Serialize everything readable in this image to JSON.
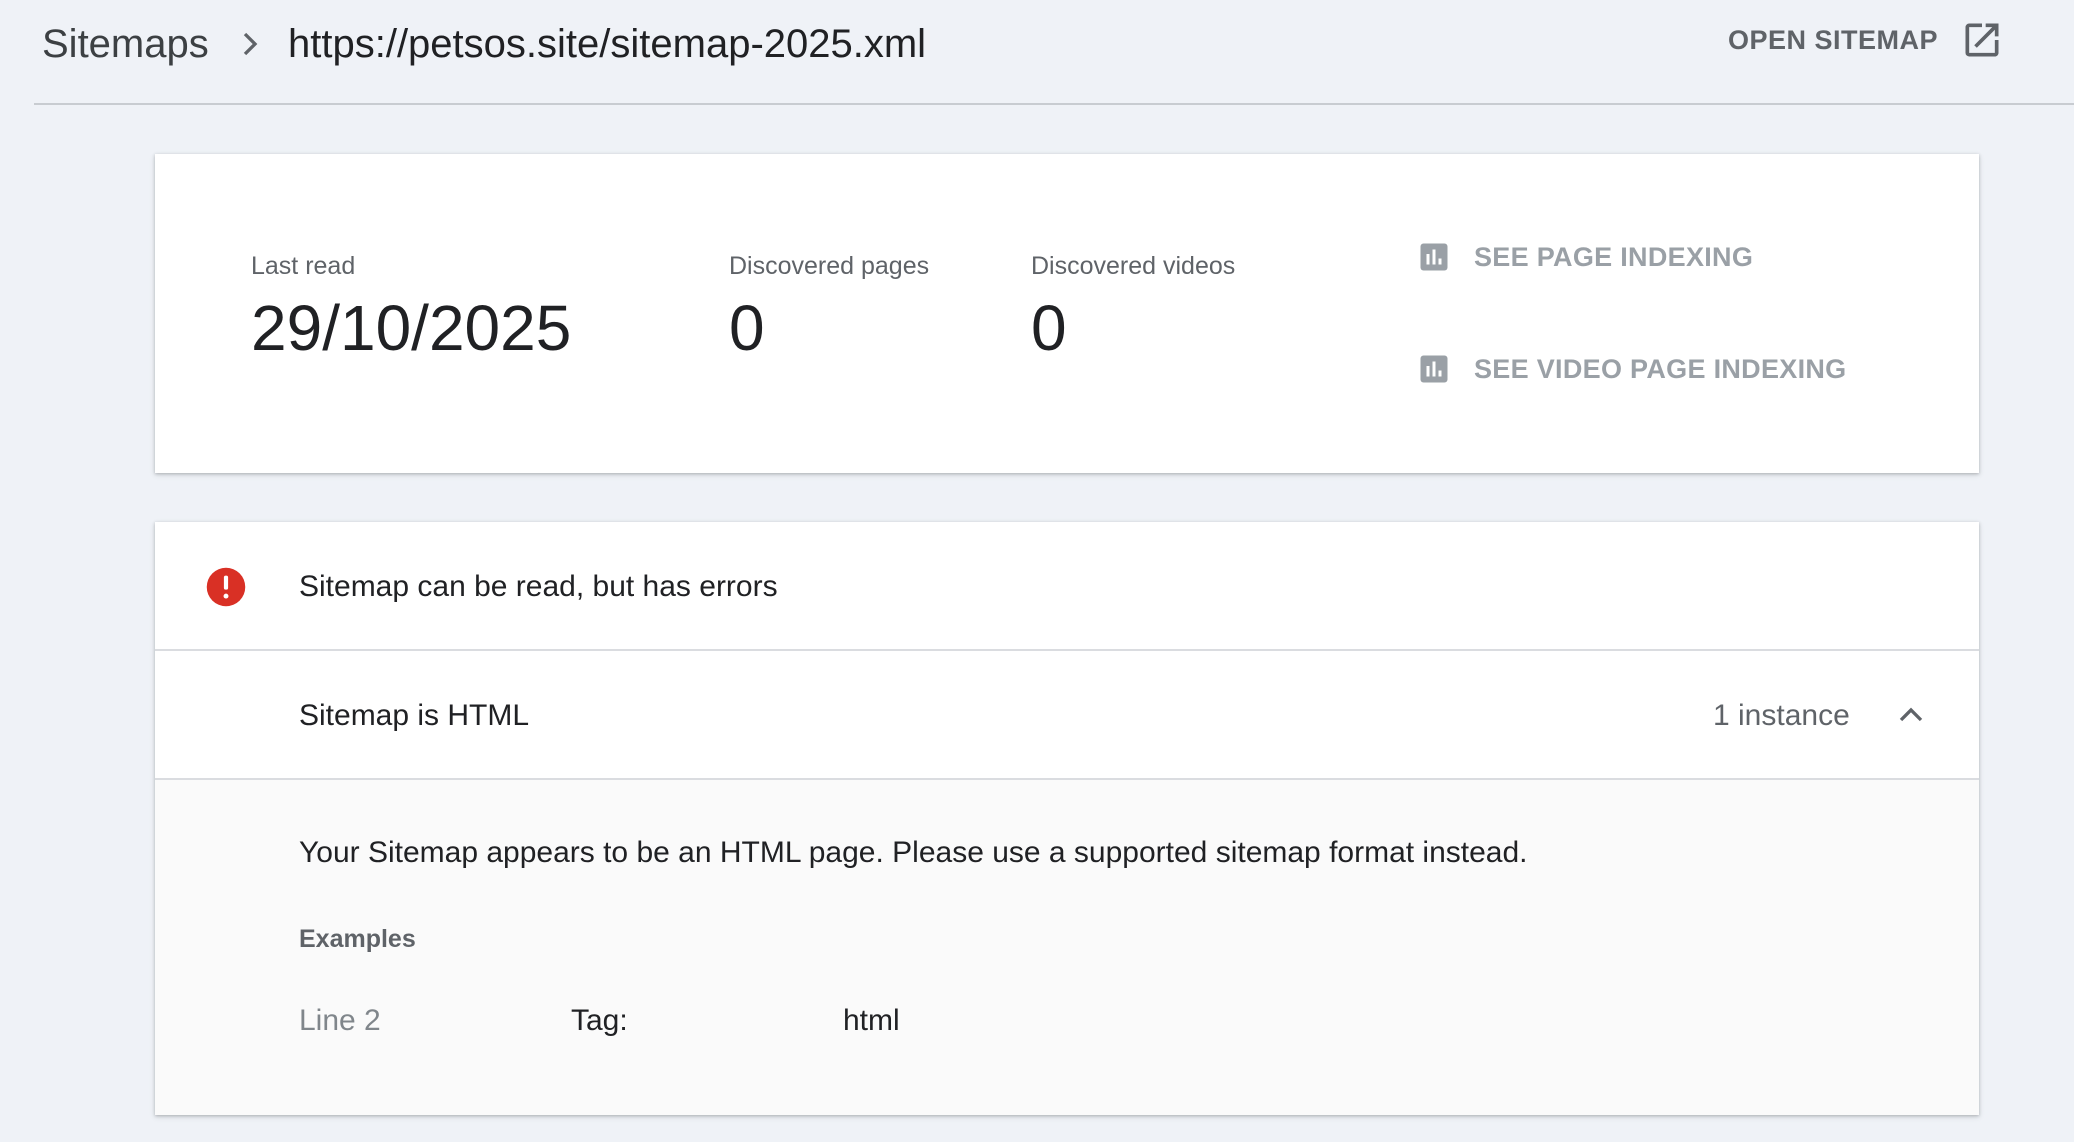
{
  "header": {
    "breadcrumb_root": "Sitemaps",
    "breadcrumb_current": "https://petsos.site/sitemap-2025.xml",
    "open_sitemap_label": "OPEN SITEMAP",
    "icons": {
      "separator": "chevron-right-icon",
      "open": "open-in-new-icon",
      "more": "more-vert-icon"
    }
  },
  "stats": {
    "last_read": {
      "label": "Last read",
      "value": "29/10/2025"
    },
    "discovered_pages": {
      "label": "Discovered pages",
      "value": "0"
    },
    "discovered_videos": {
      "label": "Discovered videos",
      "value": "0"
    },
    "links": [
      {
        "label": "SEE PAGE INDEXING",
        "icon": "bar-chart-icon"
      },
      {
        "label": "SEE VIDEO PAGE INDEXING",
        "icon": "bar-chart-icon"
      }
    ]
  },
  "errors": {
    "status": "Sitemap can be read, but has errors",
    "status_icon": "error-icon",
    "status_color": "#d93025",
    "issue": {
      "title": "Sitemap is HTML",
      "count": "1 instance",
      "expanded": true,
      "description": "Your Sitemap appears to be an HTML page. Please use a supported sitemap format instead.",
      "examples_label": "Examples",
      "examples": [
        {
          "line": "Line 2",
          "key": "Tag:",
          "value": "html"
        }
      ]
    }
  }
}
